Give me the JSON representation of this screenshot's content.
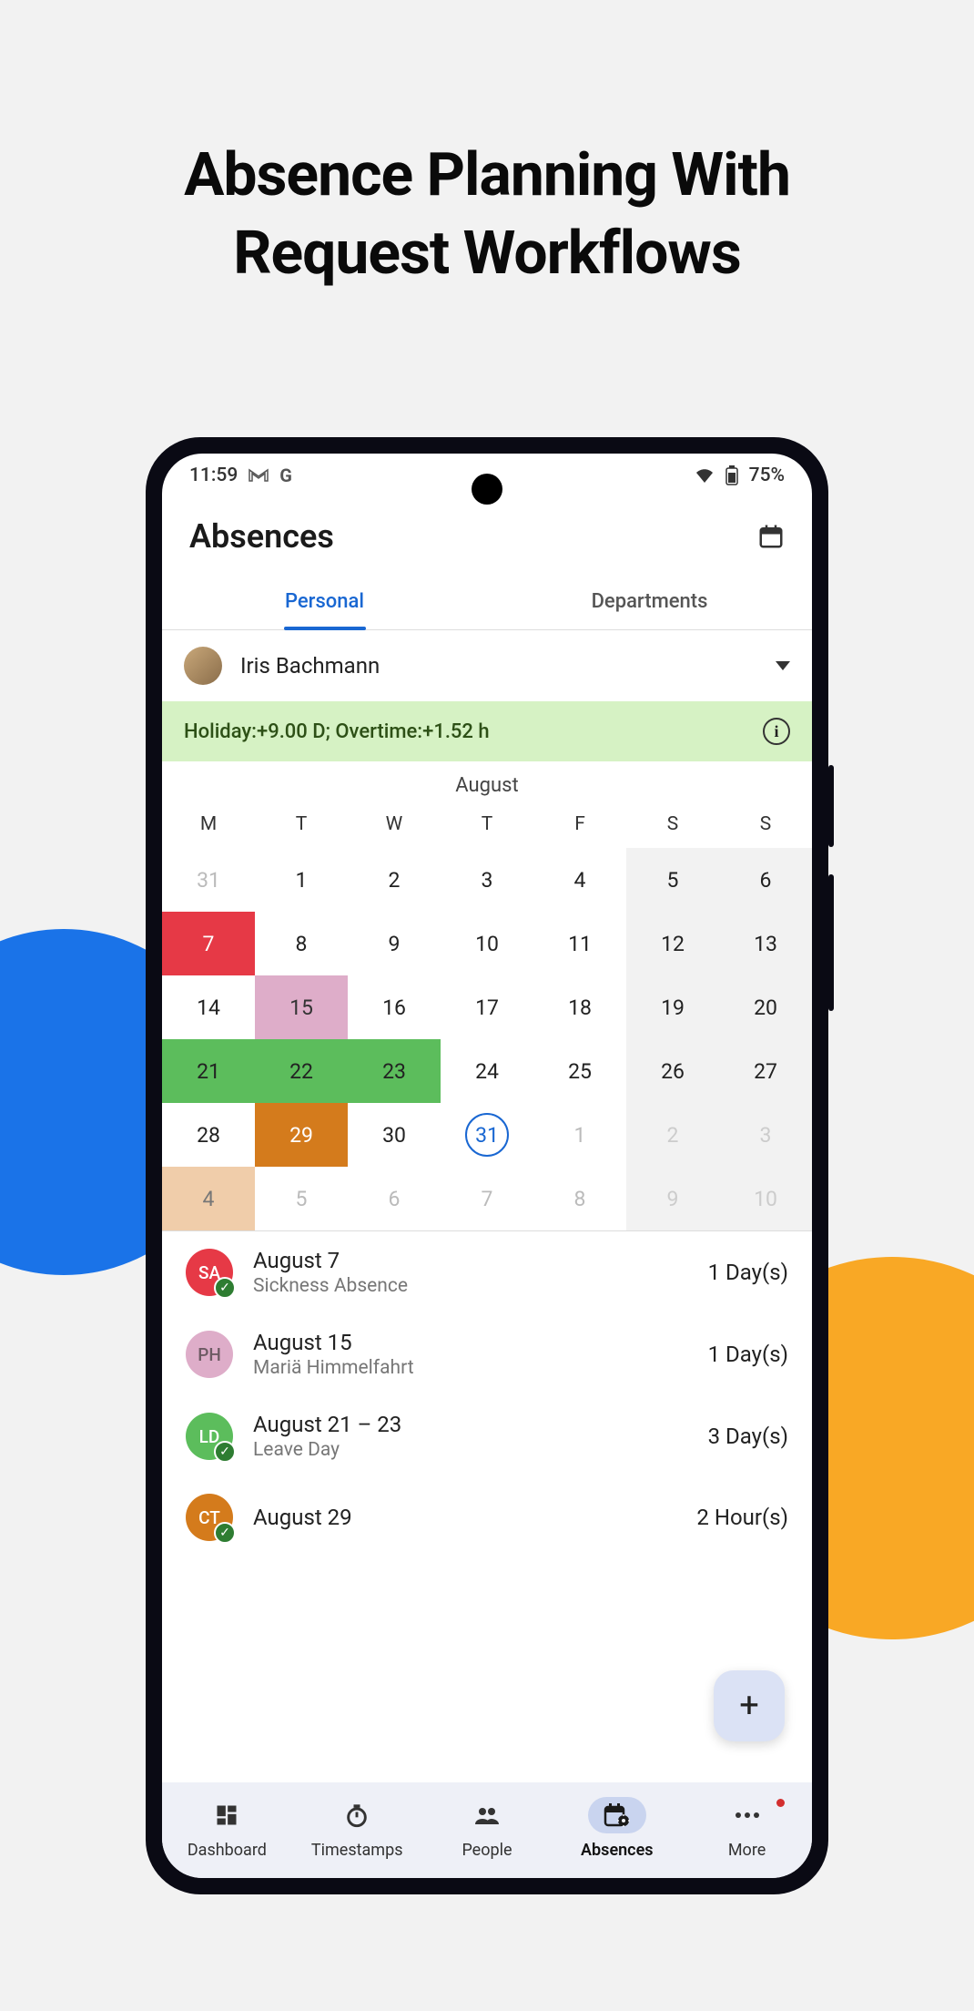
{
  "marketing": {
    "title_line1": "Absence Planning With",
    "title_line2": "Request Workflows"
  },
  "status": {
    "time": "11:59",
    "battery": "75%"
  },
  "header": {
    "title": "Absences"
  },
  "tabs": {
    "personal": "Personal",
    "departments": "Departments"
  },
  "user": {
    "name": "Iris Bachmann"
  },
  "banner": {
    "text": "Holiday:+9.00 D; Overtime:+1.52 h"
  },
  "calendar": {
    "month": "August",
    "dow": [
      "M",
      "T",
      "W",
      "T",
      "F",
      "S",
      "S"
    ],
    "rows": [
      [
        {
          "n": "31",
          "muted": true
        },
        {
          "n": "1"
        },
        {
          "n": "2"
        },
        {
          "n": "3"
        },
        {
          "n": "4"
        },
        {
          "n": "5",
          "we": true
        },
        {
          "n": "6",
          "we": true
        }
      ],
      [
        {
          "n": "7",
          "c": "red"
        },
        {
          "n": "8"
        },
        {
          "n": "9"
        },
        {
          "n": "10"
        },
        {
          "n": "11"
        },
        {
          "n": "12",
          "we": true
        },
        {
          "n": "13",
          "we": true
        }
      ],
      [
        {
          "n": "14"
        },
        {
          "n": "15",
          "c": "pink"
        },
        {
          "n": "16"
        },
        {
          "n": "17"
        },
        {
          "n": "18"
        },
        {
          "n": "19",
          "we": true
        },
        {
          "n": "20",
          "we": true
        }
      ],
      [
        {
          "n": "21",
          "c": "green"
        },
        {
          "n": "22",
          "c": "green"
        },
        {
          "n": "23",
          "c": "green"
        },
        {
          "n": "24"
        },
        {
          "n": "25"
        },
        {
          "n": "26",
          "we": true
        },
        {
          "n": "27",
          "we": true
        }
      ],
      [
        {
          "n": "28"
        },
        {
          "n": "29",
          "c": "orange"
        },
        {
          "n": "30"
        },
        {
          "n": "31",
          "today": true
        },
        {
          "n": "1",
          "muted": true
        },
        {
          "n": "2",
          "we": true,
          "muted": true
        },
        {
          "n": "3",
          "we": true,
          "muted": true
        }
      ],
      [
        {
          "n": "4",
          "c": "peach"
        },
        {
          "n": "5",
          "muted": true
        },
        {
          "n": "6",
          "muted": true
        },
        {
          "n": "7",
          "muted": true
        },
        {
          "n": "8",
          "muted": true
        },
        {
          "n": "9",
          "we": true,
          "muted": true
        },
        {
          "n": "10",
          "we": true,
          "muted": true
        }
      ]
    ]
  },
  "items": [
    {
      "code": "SA",
      "color": "sa",
      "check": true,
      "title": "August 7",
      "sub": "Sickness Absence",
      "dur": "1 Day(s)"
    },
    {
      "code": "PH",
      "color": "ph",
      "check": false,
      "title": "August 15",
      "sub": "Mariä Himmelfahrt",
      "dur": "1 Day(s)"
    },
    {
      "code": "LD",
      "color": "ld",
      "check": true,
      "title": "August 21 – 23",
      "sub": "Leave Day",
      "dur": "3 Day(s)"
    },
    {
      "code": "CT",
      "color": "ct",
      "check": true,
      "title": "August 29",
      "sub": "",
      "dur": "2 Hour(s)"
    }
  ],
  "nav": {
    "dashboard": "Dashboard",
    "timestamps": "Timestamps",
    "people": "People",
    "absences": "Absences",
    "more": "More"
  }
}
